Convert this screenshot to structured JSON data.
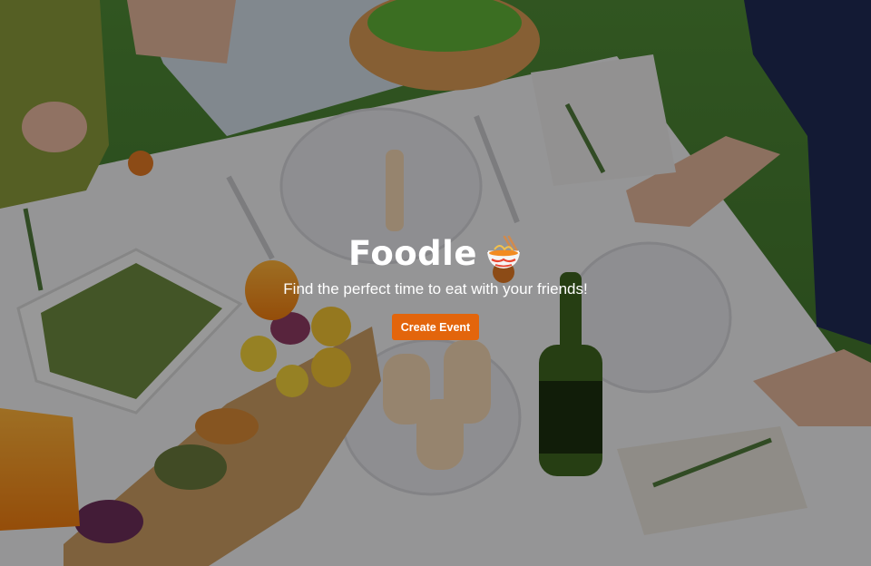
{
  "brand": {
    "name": "Foodle",
    "icon": "noodle-bowl-icon"
  },
  "hero": {
    "tagline": "Find the perfect time to eat with your friends!",
    "cta_label": "Create Event",
    "background": "photo of a table set with food, wine and candles outdoors on grass"
  },
  "colors": {
    "accent": "#e3650c",
    "text": "#ffffff"
  }
}
